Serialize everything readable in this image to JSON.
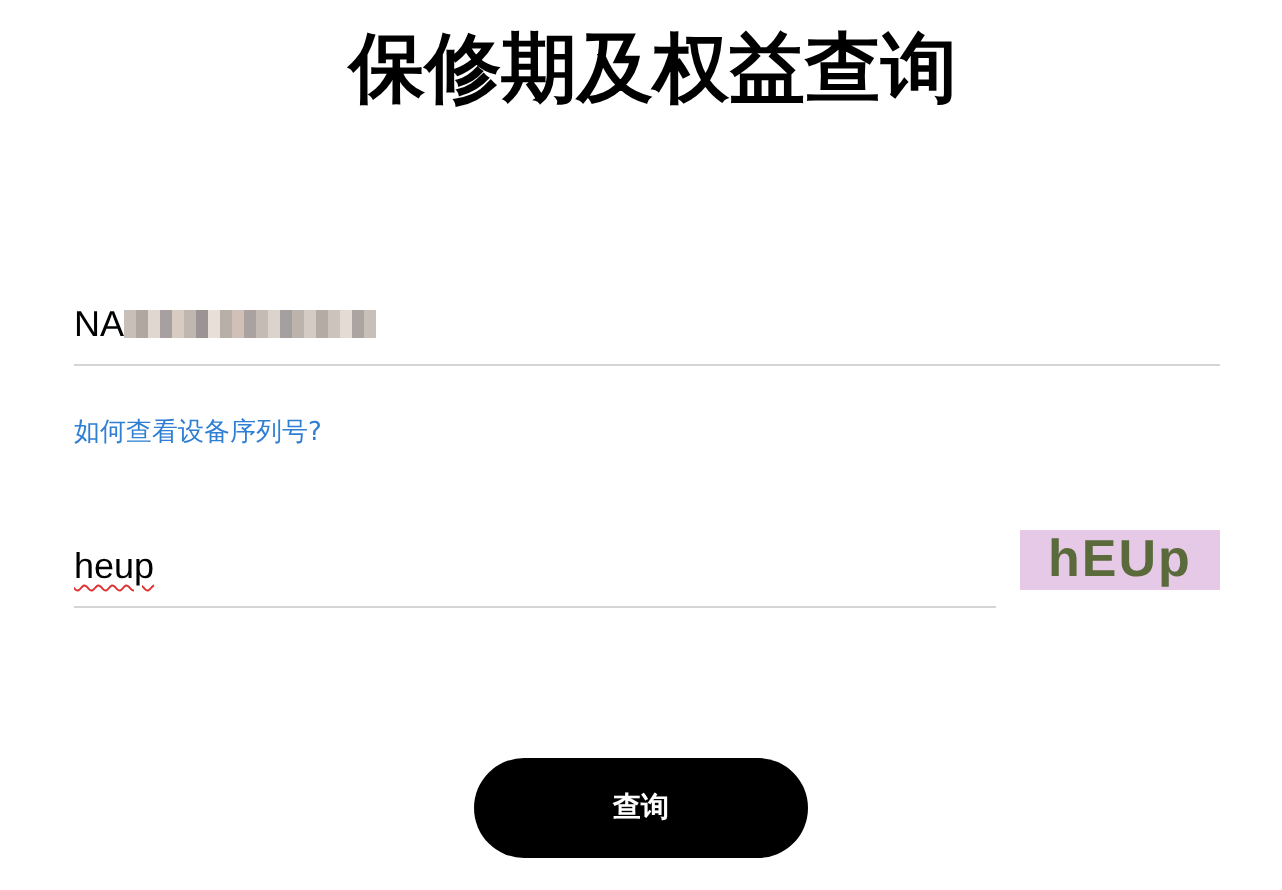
{
  "title": "保修期及权益查询",
  "serial_field": {
    "value": "NA"
  },
  "help_link": "如何查看设备序列号?",
  "captcha_field": {
    "value": "heup"
  },
  "captcha_image": {
    "text": "hEUp"
  },
  "submit_button": "查询"
}
